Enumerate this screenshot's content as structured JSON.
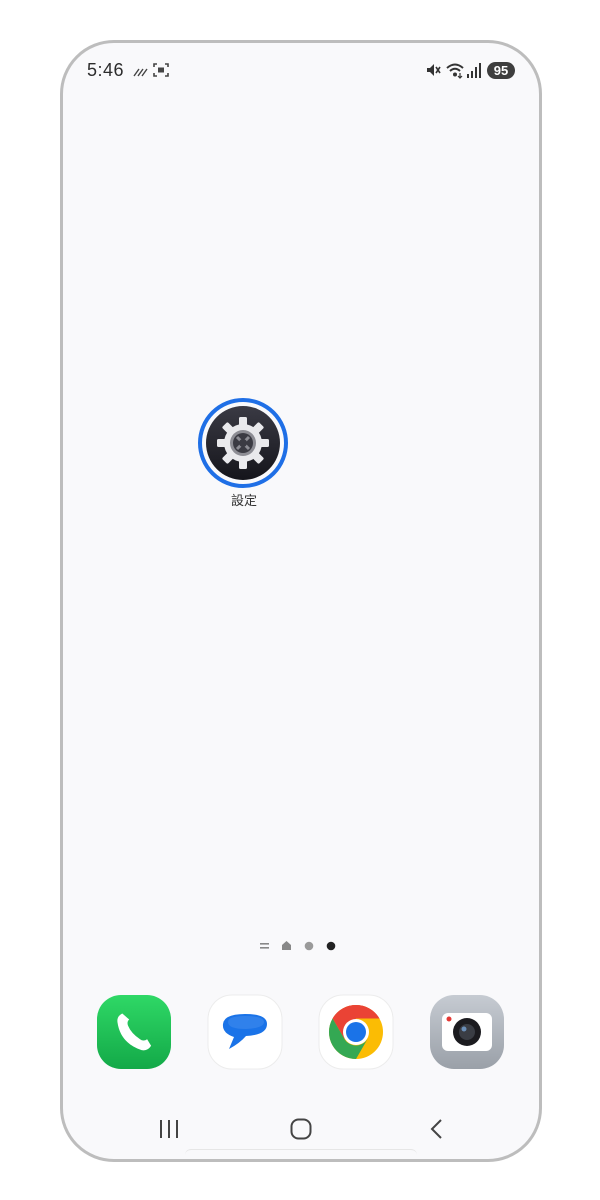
{
  "status_bar": {
    "time": "5:46",
    "battery_level": "95",
    "left_icons": [
      "signal-lines-icon",
      "screen-record-icon"
    ],
    "right_icons": [
      "mute-icon",
      "wifi-icon",
      "cell-signal-icon"
    ]
  },
  "home": {
    "apps": [
      {
        "label": "設定",
        "icon": "settings-gear-icon",
        "focused": true
      }
    ],
    "page_indicator": {
      "count": 4,
      "active_index": 3,
      "items": [
        "menu-lines-icon",
        "home-icon",
        "page-dot",
        "page-dot-active"
      ]
    }
  },
  "dock": {
    "apps": [
      {
        "icon": "phone-icon",
        "color": "#1fc353"
      },
      {
        "icon": "messages-icon",
        "color": "#1a73e8"
      },
      {
        "icon": "chrome-icon",
        "color": "#ea4335"
      },
      {
        "icon": "camera-icon",
        "color": "#9aa0a8"
      }
    ]
  },
  "navigation": {
    "buttons": [
      "recent-apps-icon",
      "home-button-icon",
      "back-icon"
    ]
  },
  "colors": {
    "focus_ring": "#1f6fe6",
    "background": "#f9f9fb"
  }
}
